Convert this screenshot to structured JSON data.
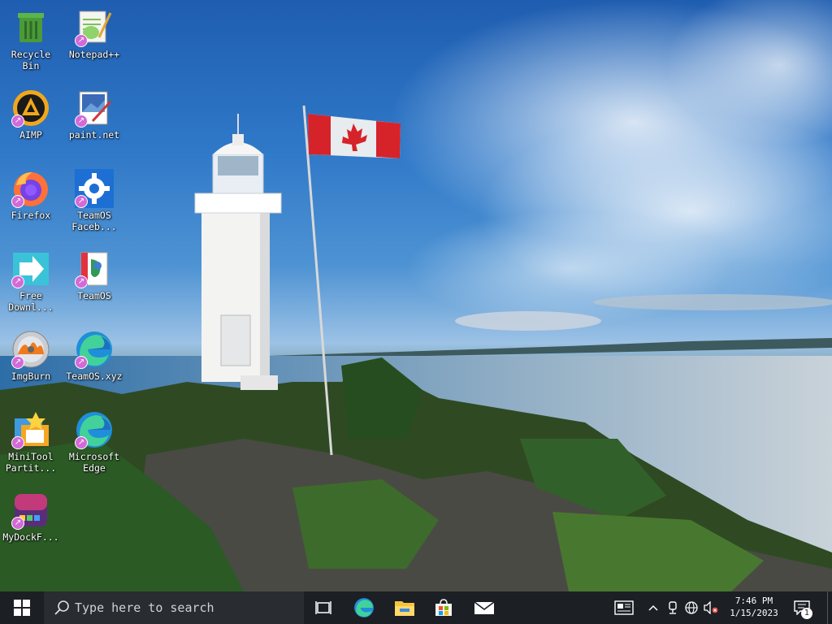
{
  "desktop": {
    "icons": [
      {
        "label": "Recycle\nBin",
        "icon": "recycle-bin-icon"
      },
      {
        "label": "Notepad++",
        "icon": "notepad-plus-plus-icon"
      },
      {
        "label": "AIMP",
        "icon": "aimp-icon"
      },
      {
        "label": "paint.net",
        "icon": "paint-net-icon"
      },
      {
        "label": "Firefox",
        "icon": "firefox-icon"
      },
      {
        "label": "TeamOS\nFaceb...",
        "icon": "teamos-facebook-icon"
      },
      {
        "label": "Free\nDownl...",
        "icon": "free-download-icon"
      },
      {
        "label": "TeamOS",
        "icon": "teamos-icon"
      },
      {
        "label": "ImgBurn",
        "icon": "imgburn-icon"
      },
      {
        "label": "TeamOS.xyz",
        "icon": "teamos-xyz-edge-icon"
      },
      {
        "label": "MiniTool\nPartit...",
        "icon": "minitool-partition-icon"
      },
      {
        "label": "Microsoft\nEdge",
        "icon": "microsoft-edge-icon"
      },
      {
        "label": "MyDockF...",
        "icon": "mydockfinder-icon"
      }
    ]
  },
  "taskbar": {
    "search_placeholder": "Type here to search",
    "pinned": [
      "task-view-icon",
      "edge-icon",
      "file-explorer-icon",
      "microsoft-store-icon",
      "mail-icon"
    ],
    "tray_icons": [
      "news-widget-icon",
      "chevron-up-icon",
      "webcam-icon",
      "network-globe-icon",
      "volume-muted-icon"
    ],
    "time": "7:46 PM",
    "date": "1/15/2023",
    "notification_count": "1"
  },
  "colors": {
    "taskbar_bg": "#1c1f24",
    "search_bg": "#292c31",
    "shortcut_badge": "#d36ad8"
  }
}
